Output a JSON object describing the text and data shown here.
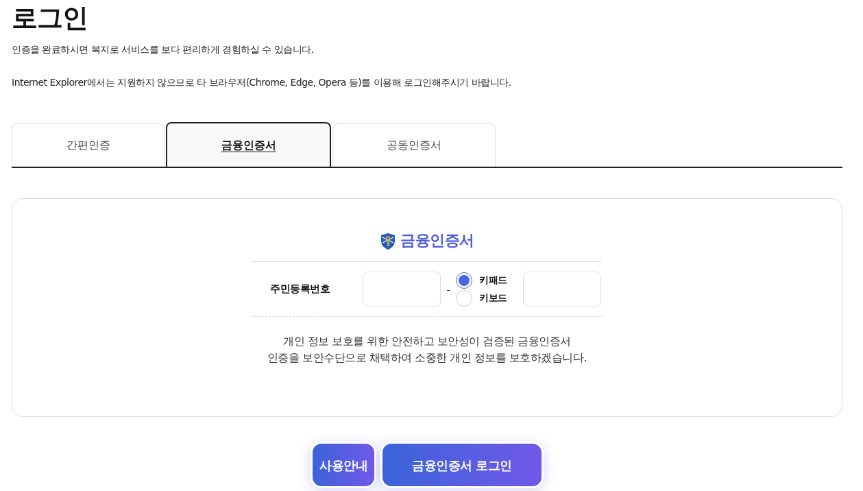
{
  "page": {
    "title": "로그인",
    "notices": [
      "인증을 완료하시면 복지로 서비스를 보다 편리하게 경험하실 수 있습니다.",
      "Internet Explorer에서는 지원하지 않으므로 타 브라우저(Chrome, Edge, Opera 등)를 이용해 로그인해주시기 바랍니다."
    ]
  },
  "tabs": [
    {
      "label": "간편인증",
      "selected": false
    },
    {
      "label": "금융인증서",
      "selected": true
    },
    {
      "label": "공동인증서",
      "selected": false
    }
  ],
  "panel": {
    "title": "금융인증서",
    "field_label": "주민등록번호",
    "separator": "-",
    "input_modes": [
      {
        "label": "키패드",
        "selected": true
      },
      {
        "label": "키보드",
        "selected": false
      }
    ],
    "description": "개인 정보 보호를 위한 안전하고 보안성이 검증된 금융인증서\n인증을 보안수단으로 채택하여 소중한 개인 정보를 보호하겠습니다."
  },
  "buttons": [
    "사용안내",
    "금융인증서 로그인"
  ]
}
